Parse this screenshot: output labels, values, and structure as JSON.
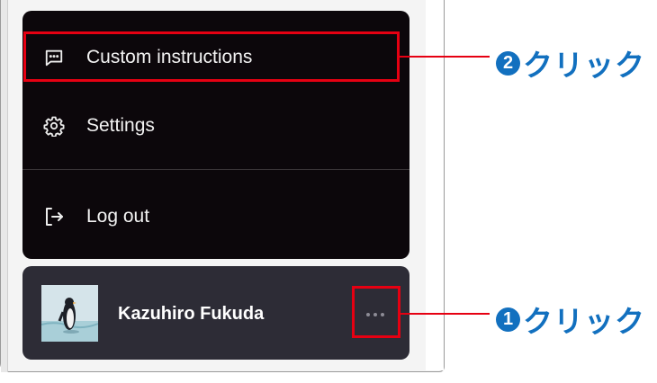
{
  "menu": {
    "items": [
      {
        "label": "Custom instructions",
        "icon": "message-square-dots-icon"
      },
      {
        "label": "Settings",
        "icon": "gear-icon"
      },
      {
        "label": "Log out",
        "icon": "log-out-icon"
      }
    ]
  },
  "profile": {
    "name": "Kazuhiro Fukuda",
    "avatar": "penguin-avatar-icon",
    "more_icon": "ellipsis-icon"
  },
  "annotations": [
    {
      "number": "2",
      "text": "クリック"
    },
    {
      "number": "1",
      "text": "クリック"
    }
  ],
  "colors": {
    "menu_bg": "#0c070b",
    "profile_bg": "#2d2c36",
    "highlight": "#e60012",
    "callout": "#1270bf"
  }
}
